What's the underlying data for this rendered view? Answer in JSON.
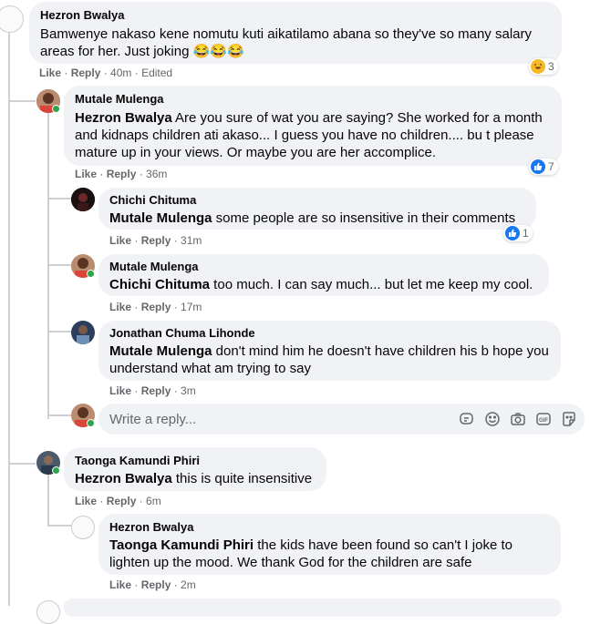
{
  "comments": [
    {
      "author": "Hezron Bwalya",
      "mention": "",
      "text": "Bamwenye nakaso kene nomutu kuti aikatilamo abana so they've so many salary areas for her. Just joking 😂😂😂",
      "like": "Like",
      "reply": "Reply",
      "time": "40m",
      "edited": "Edited",
      "reaction_count": "3",
      "reaction_icon": "laugh-emoji"
    },
    {
      "author": "Mutale Mulenga",
      "mention": "Hezron Bwalya",
      "text": " Are you sure of wat you are saying? She worked for a month and kidnaps children ati akaso... I guess you have no children.... bu t please mature up in your views. Or maybe you are her accomplice.",
      "like": "Like",
      "reply": "Reply",
      "time": "36m",
      "reaction_count": "7",
      "reaction_icon": "like-thumb"
    },
    {
      "author": "Chichi Chituma",
      "mention": "Mutale Mulenga",
      "text": " some people are so insensitive in their comments",
      "like": "Like",
      "reply": "Reply",
      "time": "31m",
      "reaction_count": "1",
      "reaction_icon": "like-thumb"
    },
    {
      "author": "Mutale Mulenga",
      "mention": "Chichi Chituma",
      "text": " too much. I can say much... but let me keep my cool.",
      "like": "Like",
      "reply": "Reply",
      "time": "17m"
    },
    {
      "author": "Jonathan Chuma Lihonde",
      "mention": "Mutale Mulenga",
      "text": " don't mind him he doesn't have children his b hope you understand what am trying to say",
      "like": "Like",
      "reply": "Reply",
      "time": "3m"
    },
    {
      "author": "Taonga Kamundi Phiri",
      "mention": "Hezron Bwalya",
      "text": " this is quite insensitive",
      "like": "Like",
      "reply": "Reply",
      "time": "6m"
    },
    {
      "author": "Hezron Bwalya",
      "mention": "Taonga Kamundi Phiri",
      "text": " the kids have been found so can't I joke to lighten up the mood. We thank God for the children are safe",
      "like": "Like",
      "reply": "Reply",
      "time": "2m"
    }
  ],
  "reply_box": {
    "placeholder": "Write a reply...",
    "icons": [
      "sticker-comment-icon",
      "emoji-icon",
      "camera-icon",
      "gif-icon",
      "sticker-icon"
    ]
  },
  "colors": {
    "bubble": "#f0f2f5",
    "online": "#31a24c",
    "like_blue": "#1877f2",
    "meta_gray": "#65676b"
  }
}
